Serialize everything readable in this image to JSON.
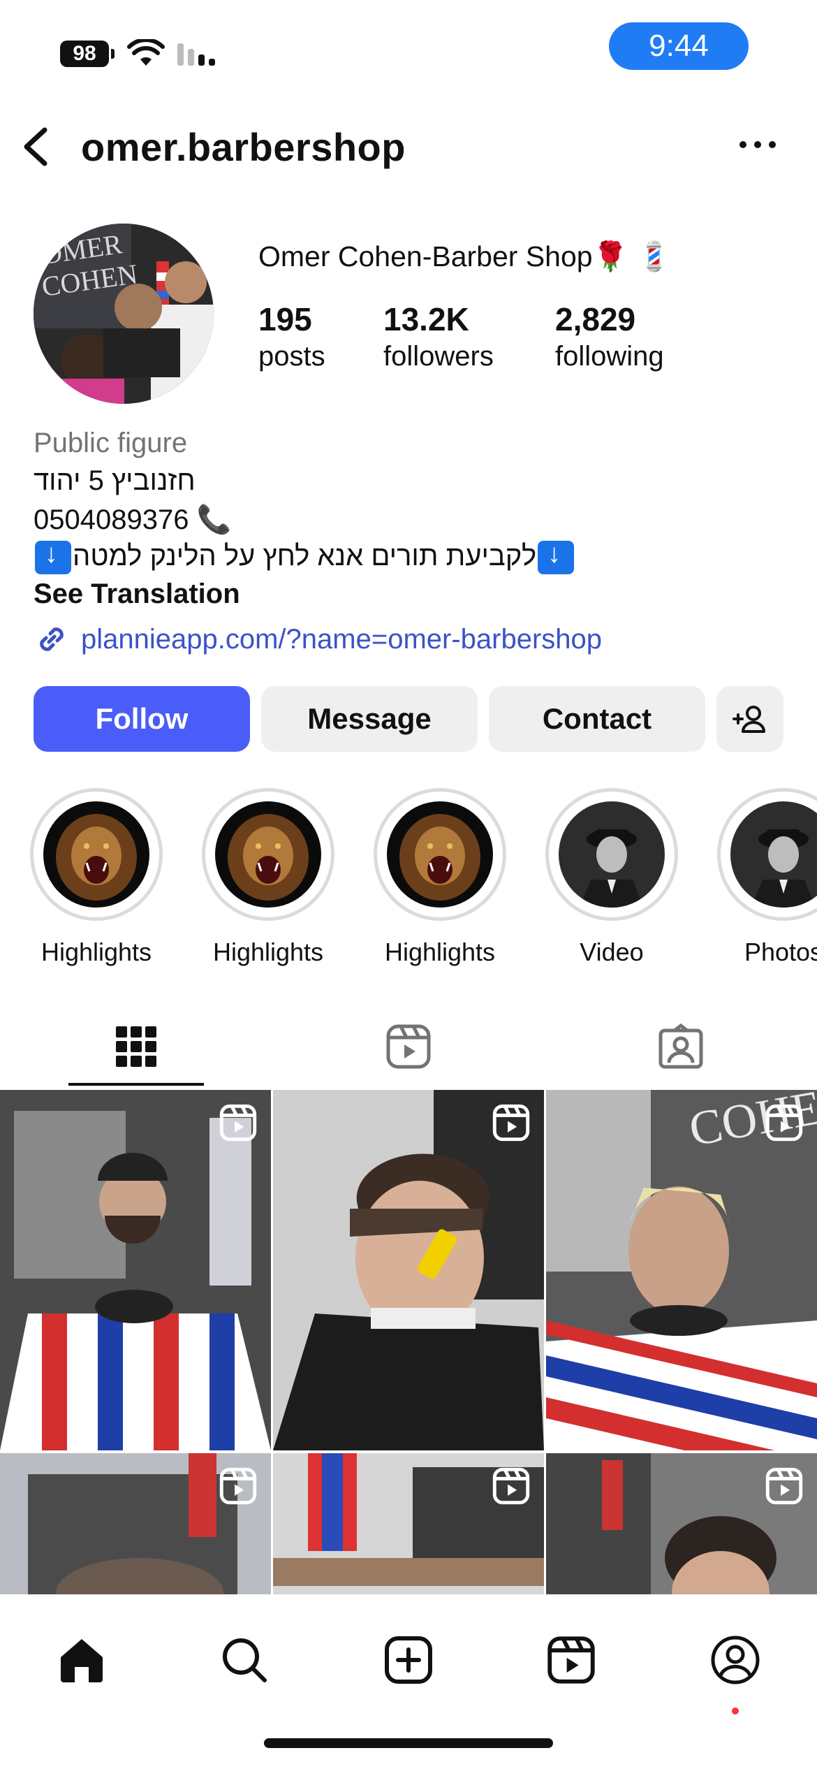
{
  "status_bar": {
    "battery": "98",
    "time": "9:44"
  },
  "header": {
    "username": "omer.barbershop"
  },
  "profile": {
    "display_name": "Omer Cohen-Barber Shop🌹 💈",
    "stats": [
      {
        "value": "195",
        "label": "posts"
      },
      {
        "value": "13.2K",
        "label": "followers"
      },
      {
        "value": "2,829",
        "label": "following"
      }
    ]
  },
  "bio": {
    "category": "Public figure",
    "address": "חזנוביץ 5 יהוד",
    "phone": "0504089376 📞",
    "booking": "לקביעת תורים אנא לחץ על הלינק למטה",
    "see_translation": "See Translation",
    "link": "plannieapp.com/?name=omer-barbershop"
  },
  "actions": {
    "follow": "Follow",
    "message": "Message",
    "contact": "Contact"
  },
  "highlights": [
    {
      "label": "Highlights",
      "icon": "lion-image"
    },
    {
      "label": "Highlights",
      "icon": "lion-image"
    },
    {
      "label": "Highlights",
      "icon": "lion-image"
    },
    {
      "label": "Video",
      "icon": "man-in-cap-image"
    },
    {
      "label": "Photos",
      "icon": "man-in-cap-image"
    }
  ],
  "tabs": [
    {
      "name": "grid",
      "icon": "grid-icon",
      "active": true
    },
    {
      "name": "reels",
      "icon": "reels-icon",
      "active": false
    },
    {
      "name": "tagged",
      "icon": "tagged-icon",
      "active": false
    }
  ],
  "bottom_nav": [
    "home-icon",
    "search-icon",
    "create-icon",
    "reels-icon",
    "profile-icon"
  ],
  "colors": {
    "follow": "#4a5df9",
    "link": "#3b52c7",
    "time_pill": "#1f7cf5",
    "notification_dot": "#ff3040"
  }
}
